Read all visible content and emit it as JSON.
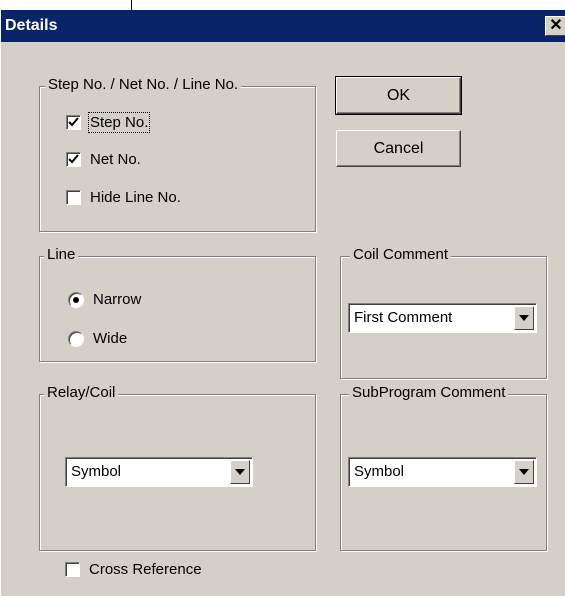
{
  "window": {
    "title": "Details",
    "close_glyph": "✕"
  },
  "buttons": {
    "ok": "OK",
    "cancel": "Cancel"
  },
  "step_group": {
    "label": "Step No. / Net No. / Line No.",
    "items": [
      {
        "label": "Step No.",
        "checked": true
      },
      {
        "label": "Net No.",
        "checked": true
      },
      {
        "label": "Hide Line No.",
        "checked": false
      }
    ]
  },
  "line_group": {
    "label": "Line",
    "options": [
      {
        "label": "Narrow",
        "selected": true
      },
      {
        "label": "Wide",
        "selected": false
      }
    ]
  },
  "coil_comment_group": {
    "label": "Coil Comment",
    "value": "First Comment"
  },
  "relay_coil_group": {
    "label": "Relay/Coil",
    "value": "Symbol"
  },
  "subprogram_group": {
    "label": "SubProgram Comment",
    "value": "Symbol"
  },
  "cross_reference": {
    "label": "Cross Reference",
    "checked": false
  }
}
